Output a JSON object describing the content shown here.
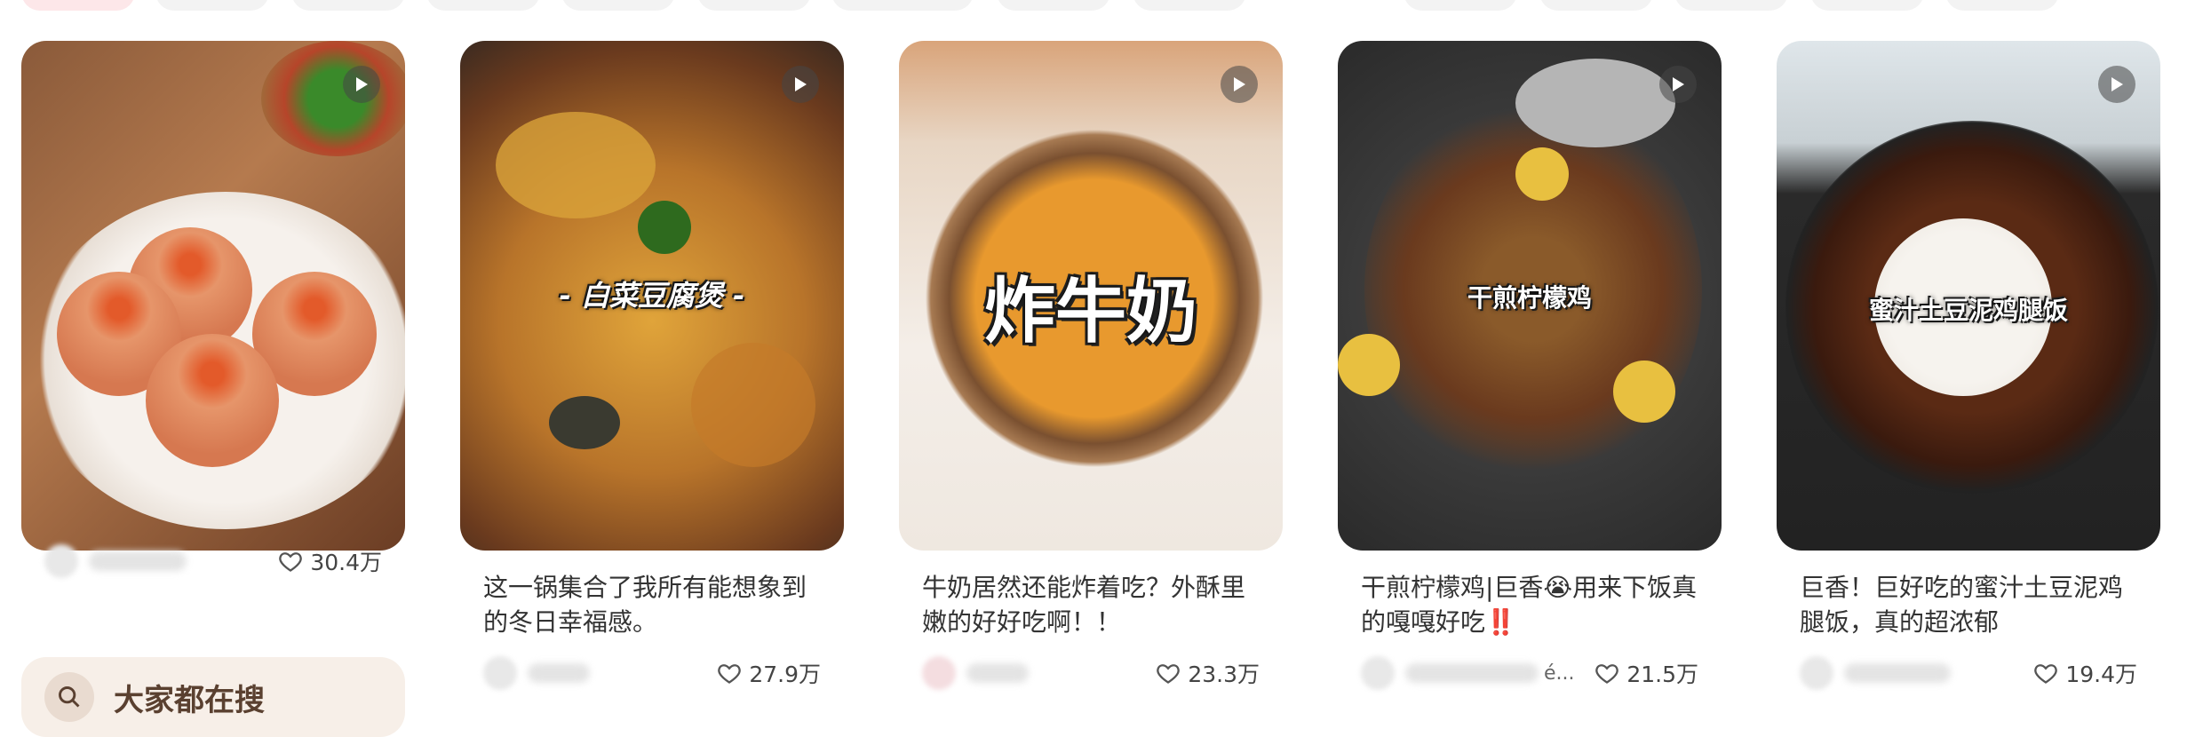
{
  "cards": [
    {
      "overlay_text": "",
      "caption": "",
      "author": "",
      "likes": "30.4万"
    },
    {
      "overlay_text": "- 白菜豆腐煲 -",
      "caption": "这一锅集合了我所有能想象到的冬日幸福感。",
      "author": "",
      "likes": "27.9万"
    },
    {
      "overlay_text": "炸牛奶",
      "caption": "牛奶居然还能炸着吃？外酥里嫩的好好吃啊！！",
      "author": "",
      "likes": "23.3万"
    },
    {
      "overlay_text": "干煎柠檬鸡",
      "caption": "干煎柠檬鸡|巨香😭用来下饭真的嘎嘎好吃‼️",
      "author": "é...",
      "likes": "21.5万"
    },
    {
      "overlay_text": "蜜汁土豆泥鸡腿饭",
      "caption": "巨香！巨好吃的蜜汁土豆泥鸡腿饭，真的超浓郁",
      "author": "",
      "likes": "19.4万"
    }
  ],
  "search_suggestion": {
    "label": "大家都在搜"
  },
  "icons": {
    "play": "play-icon",
    "heart": "heart-icon",
    "search": "search-icon"
  }
}
